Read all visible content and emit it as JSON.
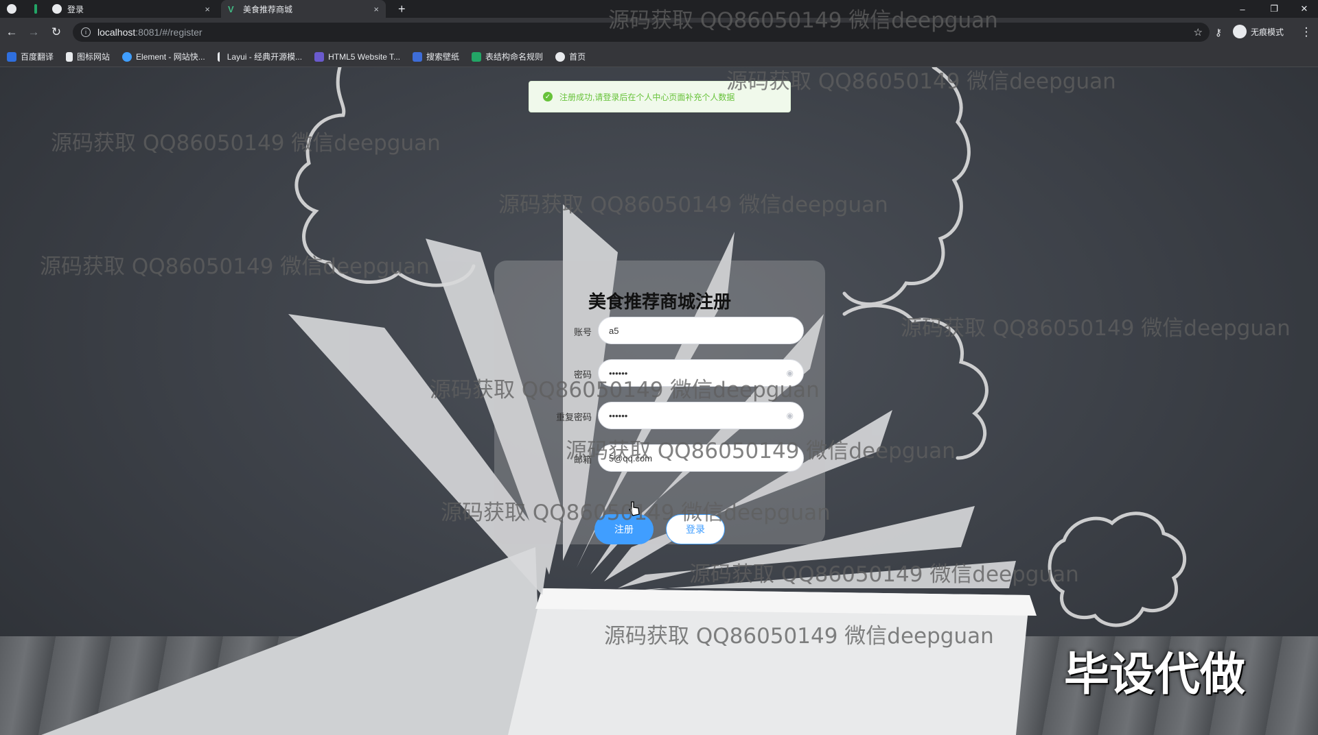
{
  "browser": {
    "tabs": [
      {
        "title": "",
        "active": false
      },
      {
        "title": "登录",
        "active": false
      },
      {
        "title": "美食推荐商城",
        "active": true
      }
    ],
    "new_tab_symbol": "+",
    "close_symbol": "×",
    "url_host": "localhost",
    "url_path": ":8081/#/register",
    "profile_label": "无痕模式",
    "bookmarks": [
      {
        "label": "百度翻译",
        "color": "#2f6fde"
      },
      {
        "label": "图标网站",
        "color": "#e8eaed"
      },
      {
        "label": "Element - 网站快...",
        "color": "#409eff"
      },
      {
        "label": "Layui - 经典开源模...",
        "color": "#e8eaed"
      },
      {
        "label": "HTML5 Website T...",
        "color": "#6a5acd"
      },
      {
        "label": "搜索壁纸",
        "color": "#3e6dd8"
      },
      {
        "label": "表结构命名规则",
        "color": "#23a566"
      },
      {
        "label": "首页",
        "color": "#e8eaed"
      }
    ]
  },
  "toast": {
    "message": "注册成功,请登录后在个人中心页面补充个人数据",
    "icon": "check-circle-icon",
    "color": "#67c23a"
  },
  "form": {
    "title": "美食推荐商城注册",
    "fields": [
      {
        "label": "账号",
        "value": "a5"
      },
      {
        "label": "密码",
        "value": "••••••"
      },
      {
        "label": "重复密码",
        "value": "••••••"
      },
      {
        "label": "邮箱",
        "value": "5@qq.com"
      }
    ],
    "register_button": "注册",
    "login_button": "登录",
    "accent": "#409eff"
  },
  "watermark": "源码获取 QQ86050149 微信deepguan",
  "corner_caption": "毕设代做"
}
